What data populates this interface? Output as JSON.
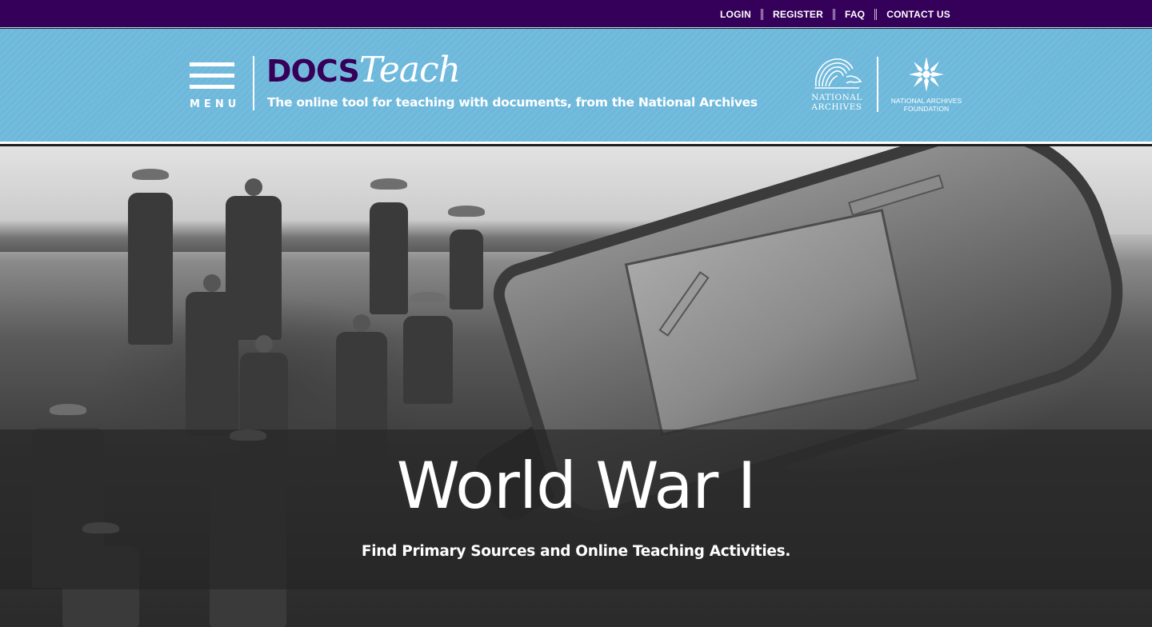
{
  "topnav": {
    "items": [
      {
        "label": "LOGIN"
      },
      {
        "label": "REGISTER"
      },
      {
        "label": "FAQ"
      },
      {
        "label": "CONTACT US"
      }
    ]
  },
  "header": {
    "menu_label": "MENU",
    "logo_docs": "DOCS",
    "logo_teach": "Teach",
    "tagline": "The online tool for teaching with documents, from the National Archives",
    "national_archives": {
      "line1": "NATIONAL",
      "line2": "ARCHIVES",
      "icon": "eagle-icon"
    },
    "foundation": {
      "line1": "NATIONAL ARCHIVES",
      "line2": "FOUNDATION",
      "icon": "star-icon"
    }
  },
  "hero": {
    "title": "World War I",
    "subtitle": "Find Primary Sources and Online Teaching Activities.",
    "image_subject": "ww1-tank-trench-photo"
  },
  "colors": {
    "topbar": "#34005a",
    "header": "#6db8db",
    "logo_docs": "#34005a",
    "text_on_dark": "#ffffff"
  }
}
